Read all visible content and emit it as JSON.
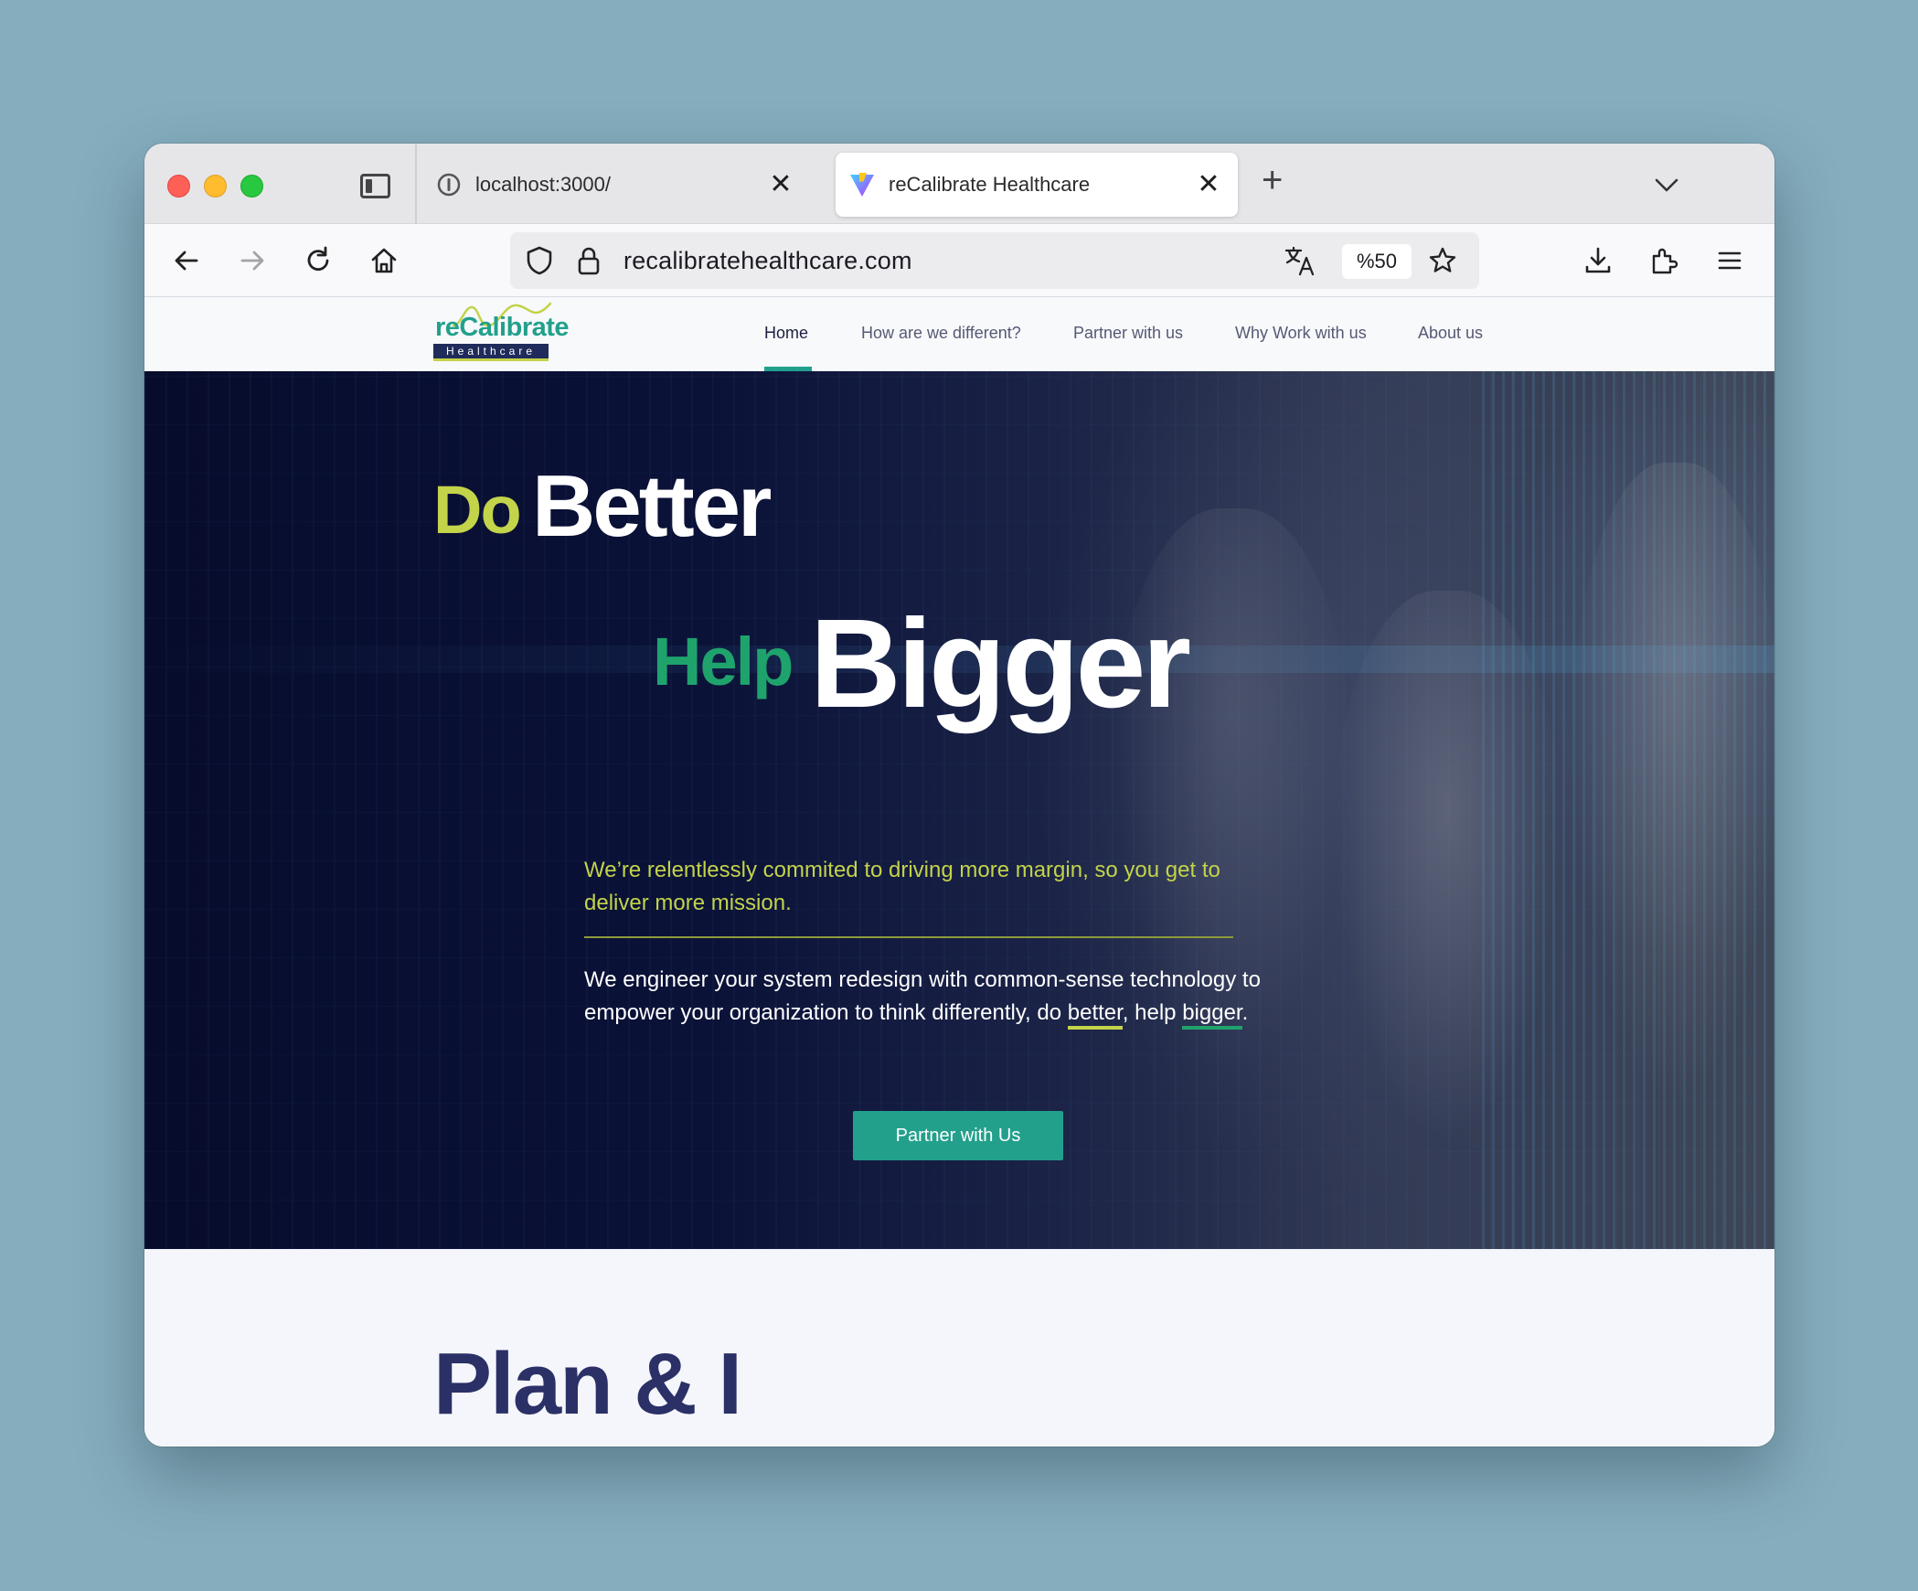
{
  "browser": {
    "tabs": [
      {
        "title": "localhost:3000/",
        "close": "✕"
      },
      {
        "title": "reCalibrate Healthcare",
        "close": "✕"
      }
    ],
    "new_tab": "+",
    "url": "recalibratehealthcare.com",
    "zoom": "%50"
  },
  "site": {
    "logo": {
      "name": "reCalibrate",
      "sub": "Healthcare"
    },
    "nav": [
      {
        "label": "Home",
        "active": true
      },
      {
        "label": "How are we different?"
      },
      {
        "label": "Partner with us"
      },
      {
        "label": "Why Work with us"
      },
      {
        "label": "About us"
      }
    ]
  },
  "hero": {
    "do": "Do",
    "better": "Better",
    "help": "Help",
    "bigger": "Bigger",
    "tagline": "We’re relentlessly commited to driving more margin, so you get to deliver more mission.",
    "desc_prefix": "We engineer your system redesign with common-sense technology to empower your organization to think differently, do ",
    "desc_better": "better",
    "desc_mid": ", help ",
    "desc_bigger": "bigger",
    "desc_end": ".",
    "cta": "Partner with Us"
  },
  "next_section": {
    "heading": "Plan & I"
  },
  "colors": {
    "accent_teal": "#23a08c",
    "lime": "#c3d34a",
    "green": "#1fa36c",
    "navy": "#2b3166"
  }
}
